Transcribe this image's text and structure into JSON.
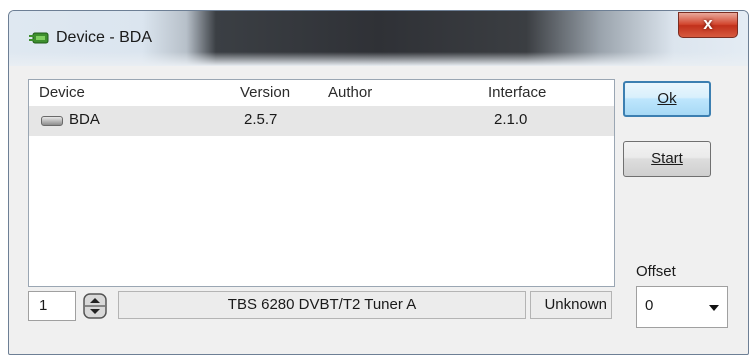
{
  "window": {
    "title": "Device - BDA",
    "close_glyph": "x"
  },
  "list": {
    "columns": [
      "Device",
      "Version",
      "Author",
      "Interface"
    ],
    "rows": [
      {
        "device": "BDA",
        "version": "2.5.7",
        "author": "",
        "interface": "2.1.0",
        "icon": "device-icon",
        "selected": true
      }
    ]
  },
  "buttons": {
    "ok": "Ok",
    "start": "Start"
  },
  "offset": {
    "label": "Offset",
    "value": "0"
  },
  "tuner": {
    "index": "1",
    "name": "TBS 6280 DVBT/T2 Tuner A",
    "status": "Unknown"
  },
  "colors": {
    "close_button": "#c83a22",
    "selection": "#e6e6e6",
    "default_button_border": "#3c7fb1"
  }
}
